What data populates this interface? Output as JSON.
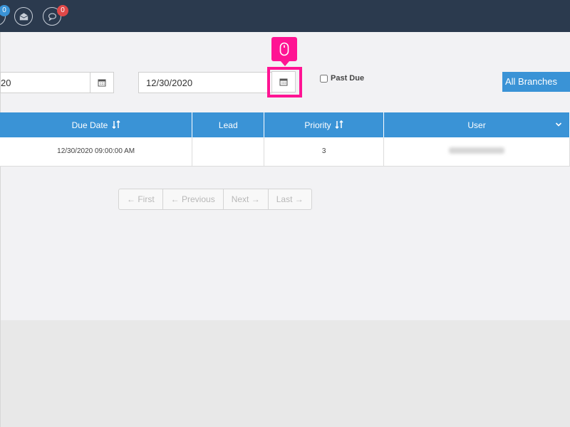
{
  "topbar": {
    "badges": [
      "0",
      "0"
    ]
  },
  "filters": {
    "start_date_partial": "20",
    "end_date": "12/30/2020",
    "past_due_label": "Past Due",
    "branches_label": "All Branches"
  },
  "table": {
    "headers": {
      "due_date": "Due Date",
      "lead": "Lead",
      "priority": "Priority",
      "user": "User"
    },
    "rows": [
      {
        "due_date": "12/30/2020 09:00:00 AM",
        "lead": "",
        "priority": "3",
        "user": ""
      }
    ]
  },
  "pagination": {
    "first": "← First",
    "previous": "← Previous",
    "next": "Next →",
    "last": "Last →"
  },
  "colors": {
    "topbar": "#2b3a4e",
    "accent": "#3a93d6",
    "highlight": "#ff1493",
    "badge_blue": "#3a93d6",
    "badge_red": "#e04848"
  },
  "icons": [
    "user-icon",
    "mail-open-icon",
    "chat-icon",
    "calendar-icon",
    "mouse-icon",
    "sort-icon",
    "chevron-down-icon"
  ]
}
